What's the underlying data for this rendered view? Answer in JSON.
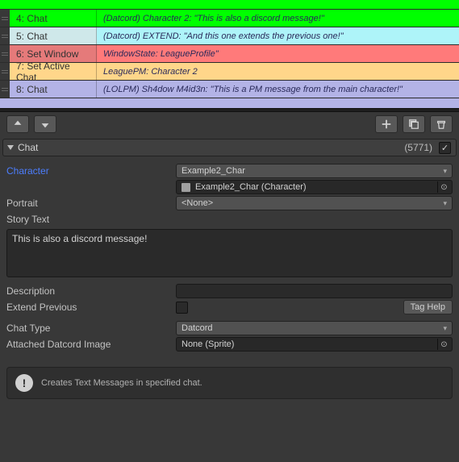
{
  "rows": [
    {
      "num": "4:",
      "type": "Chat",
      "label_bg": "#00ff00",
      "content_bg": "#00ff00",
      "text": "(Datcord) Character 2: \"This is also a discord message!\""
    },
    {
      "num": "5:",
      "type": "Chat",
      "label_bg": "#cfe8ea",
      "content_bg": "#aef4f9",
      "text": "(Datcord) EXTEND: \"And this one extends the previous one!\""
    },
    {
      "num": "6:",
      "type": "Set Window",
      "label_bg": "#e57a7a",
      "content_bg": "#ff7a7a",
      "text": "WindowState: LeagueProfile\""
    },
    {
      "num": "7:",
      "type": "Set Active Chat",
      "label_bg": "#ffd68a",
      "content_bg": "#ffd68a",
      "text": "LeaguePM: Character 2"
    },
    {
      "num": "8:",
      "type": "Chat",
      "label_bg": "#b3b3e6",
      "content_bg": "#b3b3e6",
      "text": "(LOLPM) Sh4dow M4id3n: \"This is a PM message from the main character!\""
    }
  ],
  "section": {
    "title": "Chat",
    "count": "(5771)"
  },
  "fields": {
    "character_label": "Character",
    "character_value": "Example2_Char",
    "character_object": "Example2_Char (Character)",
    "portrait_label": "Portrait",
    "portrait_value": "<None>",
    "story_text_label": "Story Text",
    "story_text_value": "This is also a discord message!",
    "description_label": "Description",
    "description_value": "",
    "extend_prev_label": "Extend Previous",
    "tag_help": "Tag Help",
    "chat_type_label": "Chat Type",
    "chat_type_value": "Datcord",
    "attached_img_label": "Attached Datcord Image",
    "attached_img_value": "None (Sprite)"
  },
  "help": "Creates Text Messages in specified chat."
}
